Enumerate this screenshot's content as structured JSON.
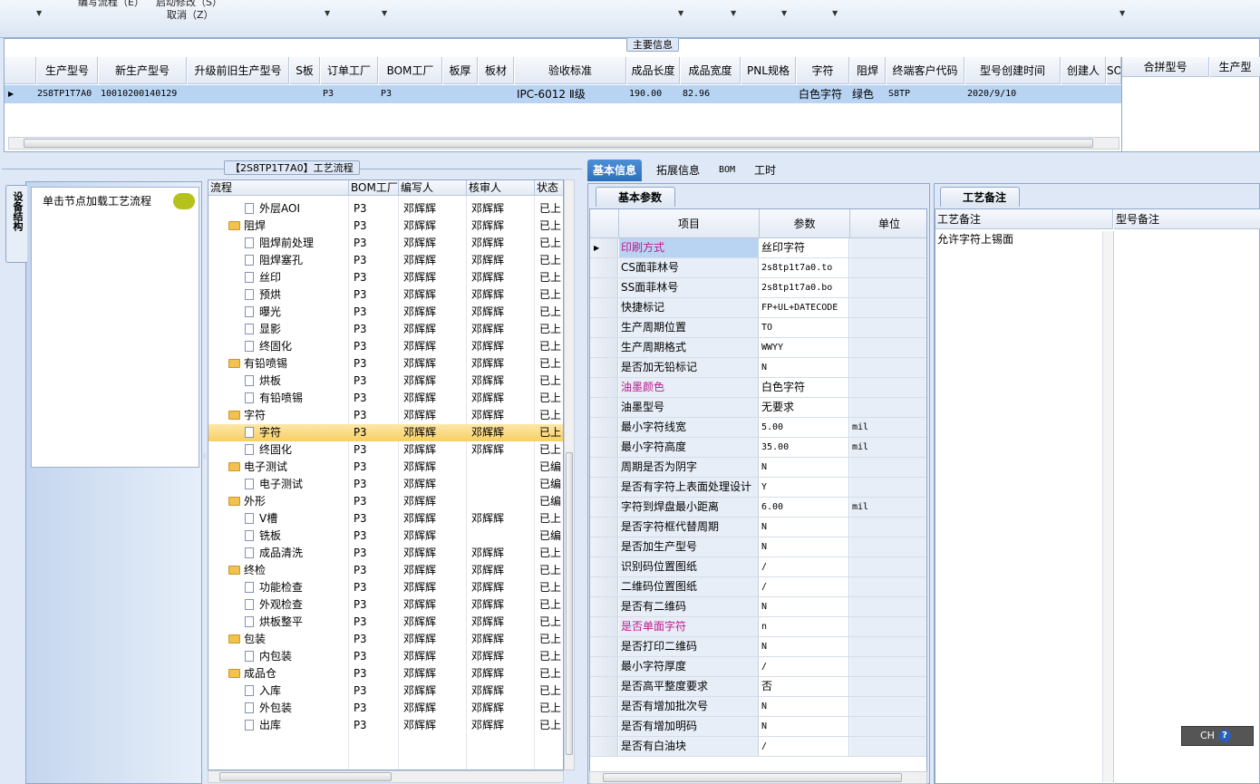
{
  "toolbar": {
    "menu_line1_a": "编写流程（E）",
    "menu_line1_b": "启动修改（S）",
    "menu_cancel": "取消（Z）"
  },
  "main_info": {
    "legend": "主要信息",
    "columns": [
      "生产型号",
      "新生产型号",
      "升级前旧生产型号",
      "S板",
      "订单工厂",
      "BOM工厂",
      "板厚",
      "板材",
      "验收标准",
      "成品长度",
      "成品宽度",
      "PNL规格",
      "字符",
      "阻焊",
      "终端客户代码",
      "型号创建时间",
      "创建人",
      "SO"
    ],
    "row": [
      "2S8TP1T7A0",
      "10010200140129",
      "",
      "",
      "P3",
      "P3",
      "",
      "",
      "IPC-6012 Ⅱ级",
      "190.00",
      "82.96",
      "",
      "白色字符",
      "绿色",
      "S8TP",
      "2020/9/10",
      "",
      ""
    ],
    "side_columns": [
      "合拼型号",
      "生产型"
    ]
  },
  "left": {
    "panel_title": "【2S8TP1T7A0】工艺流程",
    "vertical_tab": "设备结构",
    "hint": "单击节点加载工艺流程",
    "columns": [
      "流程",
      "BOM工厂",
      "编写人",
      "核审人",
      "状态"
    ],
    "rows": [
      {
        "name": "外层AOI",
        "level": 2,
        "bom": "P3",
        "writer": "邓辉辉",
        "reviewer": "邓辉辉",
        "status": "已上"
      },
      {
        "name": "阻焊",
        "level": 1,
        "bom": "P3",
        "writer": "邓辉辉",
        "reviewer": "邓辉辉",
        "status": "已上"
      },
      {
        "name": "阻焊前处理",
        "level": 2,
        "bom": "P3",
        "writer": "邓辉辉",
        "reviewer": "邓辉辉",
        "status": "已上"
      },
      {
        "name": "阻焊塞孔",
        "level": 2,
        "bom": "P3",
        "writer": "邓辉辉",
        "reviewer": "邓辉辉",
        "status": "已上"
      },
      {
        "name": "丝印",
        "level": 2,
        "bom": "P3",
        "writer": "邓辉辉",
        "reviewer": "邓辉辉",
        "status": "已上"
      },
      {
        "name": "预烘",
        "level": 2,
        "bom": "P3",
        "writer": "邓辉辉",
        "reviewer": "邓辉辉",
        "status": "已上"
      },
      {
        "name": "曝光",
        "level": 2,
        "bom": "P3",
        "writer": "邓辉辉",
        "reviewer": "邓辉辉",
        "status": "已上"
      },
      {
        "name": "显影",
        "level": 2,
        "bom": "P3",
        "writer": "邓辉辉",
        "reviewer": "邓辉辉",
        "status": "已上"
      },
      {
        "name": "终固化",
        "level": 2,
        "bom": "P3",
        "writer": "邓辉辉",
        "reviewer": "邓辉辉",
        "status": "已上"
      },
      {
        "name": "有铅喷锡",
        "level": 1,
        "bom": "P3",
        "writer": "邓辉辉",
        "reviewer": "邓辉辉",
        "status": "已上"
      },
      {
        "name": "烘板",
        "level": 2,
        "bom": "P3",
        "writer": "邓辉辉",
        "reviewer": "邓辉辉",
        "status": "已上"
      },
      {
        "name": "有铅喷锡",
        "level": 2,
        "bom": "P3",
        "writer": "邓辉辉",
        "reviewer": "邓辉辉",
        "status": "已上"
      },
      {
        "name": "字符",
        "level": 1,
        "bom": "P3",
        "writer": "邓辉辉",
        "reviewer": "邓辉辉",
        "status": "已上"
      },
      {
        "name": "字符",
        "level": 2,
        "bom": "P3",
        "writer": "邓辉辉",
        "reviewer": "邓辉辉",
        "status": "已上",
        "selected": true
      },
      {
        "name": "终固化",
        "level": 2,
        "bom": "P3",
        "writer": "邓辉辉",
        "reviewer": "邓辉辉",
        "status": "已上"
      },
      {
        "name": "电子测试",
        "level": 1,
        "bom": "P3",
        "writer": "邓辉辉",
        "reviewer": "",
        "status": "已编"
      },
      {
        "name": "电子测试",
        "level": 2,
        "bom": "P3",
        "writer": "邓辉辉",
        "reviewer": "",
        "status": "已编"
      },
      {
        "name": "外形",
        "level": 1,
        "bom": "P3",
        "writer": "邓辉辉",
        "reviewer": "",
        "status": "已编"
      },
      {
        "name": "V槽",
        "level": 2,
        "bom": "P3",
        "writer": "邓辉辉",
        "reviewer": "邓辉辉",
        "status": "已上"
      },
      {
        "name": "铣板",
        "level": 2,
        "bom": "P3",
        "writer": "邓辉辉",
        "reviewer": "",
        "status": "已编"
      },
      {
        "name": "成品清洗",
        "level": 2,
        "bom": "P3",
        "writer": "邓辉辉",
        "reviewer": "邓辉辉",
        "status": "已上"
      },
      {
        "name": "终检",
        "level": 1,
        "bom": "P3",
        "writer": "邓辉辉",
        "reviewer": "邓辉辉",
        "status": "已上"
      },
      {
        "name": "功能检查",
        "level": 2,
        "bom": "P3",
        "writer": "邓辉辉",
        "reviewer": "邓辉辉",
        "status": "已上"
      },
      {
        "name": "外观检查",
        "level": 2,
        "bom": "P3",
        "writer": "邓辉辉",
        "reviewer": "邓辉辉",
        "status": "已上"
      },
      {
        "name": "烘板整平",
        "level": 2,
        "bom": "P3",
        "writer": "邓辉辉",
        "reviewer": "邓辉辉",
        "status": "已上"
      },
      {
        "name": "包装",
        "level": 1,
        "bom": "P3",
        "writer": "邓辉辉",
        "reviewer": "邓辉辉",
        "status": "已上"
      },
      {
        "name": "内包装",
        "level": 2,
        "bom": "P3",
        "writer": "邓辉辉",
        "reviewer": "邓辉辉",
        "status": "已上"
      },
      {
        "name": "成品仓",
        "level": 1,
        "bom": "P3",
        "writer": "邓辉辉",
        "reviewer": "邓辉辉",
        "status": "已上"
      },
      {
        "name": "入库",
        "level": 2,
        "bom": "P3",
        "writer": "邓辉辉",
        "reviewer": "邓辉辉",
        "status": "已上"
      },
      {
        "name": "外包装",
        "level": 2,
        "bom": "P3",
        "writer": "邓辉辉",
        "reviewer": "邓辉辉",
        "status": "已上"
      },
      {
        "name": "出库",
        "level": 2,
        "bom": "P3",
        "writer": "邓辉辉",
        "reviewer": "邓辉辉",
        "status": "已上"
      }
    ]
  },
  "right": {
    "tabs": [
      "基本信息",
      "拓展信息",
      "BOM",
      "工时"
    ],
    "param_tab": "基本参数",
    "param_columns": [
      "项目",
      "参数",
      "单位"
    ],
    "params": [
      {
        "item": "印刷方式",
        "value": "丝印字符",
        "unit": "",
        "highlight": true
      },
      {
        "item": "CS面菲林号",
        "value": "2s8tp1t7a0.to",
        "unit": ""
      },
      {
        "item": "SS面菲林号",
        "value": "2s8tp1t7a0.bo",
        "unit": ""
      },
      {
        "item": "快捷标记",
        "value": "FP+UL+DATECODE",
        "unit": ""
      },
      {
        "item": "生产周期位置",
        "value": "TO",
        "unit": ""
      },
      {
        "item": "生产周期格式",
        "value": "WWYY",
        "unit": ""
      },
      {
        "item": "是否加无铅标记",
        "value": "N",
        "unit": ""
      },
      {
        "item": "油墨颜色",
        "value": "白色字符",
        "unit": "",
        "highlight": true
      },
      {
        "item": "油墨型号",
        "value": "无要求",
        "unit": ""
      },
      {
        "item": "最小字符线宽",
        "value": "5.00",
        "unit": "mil"
      },
      {
        "item": "最小字符高度",
        "value": "35.00",
        "unit": "mil"
      },
      {
        "item": "周期是否为阴字",
        "value": "N",
        "unit": ""
      },
      {
        "item": "是否有字符上表面处理设计",
        "value": "Y",
        "unit": ""
      },
      {
        "item": "字符到焊盘最小距离",
        "value": "6.00",
        "unit": "mil"
      },
      {
        "item": "是否字符框代替周期",
        "value": "N",
        "unit": ""
      },
      {
        "item": "是否加生产型号",
        "value": "N",
        "unit": ""
      },
      {
        "item": "识别码位置图纸",
        "value": "/",
        "unit": ""
      },
      {
        "item": "二维码位置图纸",
        "value": "/",
        "unit": ""
      },
      {
        "item": "是否有二维码",
        "value": "N",
        "unit": ""
      },
      {
        "item": "是否单面字符",
        "value": "n",
        "unit": "",
        "highlight": true
      },
      {
        "item": "是否打印二维码",
        "value": "N",
        "unit": ""
      },
      {
        "item": "最小字符厚度",
        "value": "/",
        "unit": ""
      },
      {
        "item": "是否高平整度要求",
        "value": "否",
        "unit": ""
      },
      {
        "item": "是否有增加批次号",
        "value": "N",
        "unit": ""
      },
      {
        "item": "是否有增加明码",
        "value": "N",
        "unit": ""
      },
      {
        "item": "是否有白油块",
        "value": "/",
        "unit": ""
      }
    ],
    "notes_tab": "工艺备注",
    "notes_columns": [
      "工艺备注",
      "型号备注"
    ],
    "process_note": "允许字符上锡面",
    "model_note": ""
  },
  "ime": {
    "label": "CH",
    "help": "?"
  },
  "colors": {
    "selected_row": "#f8cf63",
    "highlight_text": "#c0188c",
    "active_tab": "#2d6fbd"
  }
}
